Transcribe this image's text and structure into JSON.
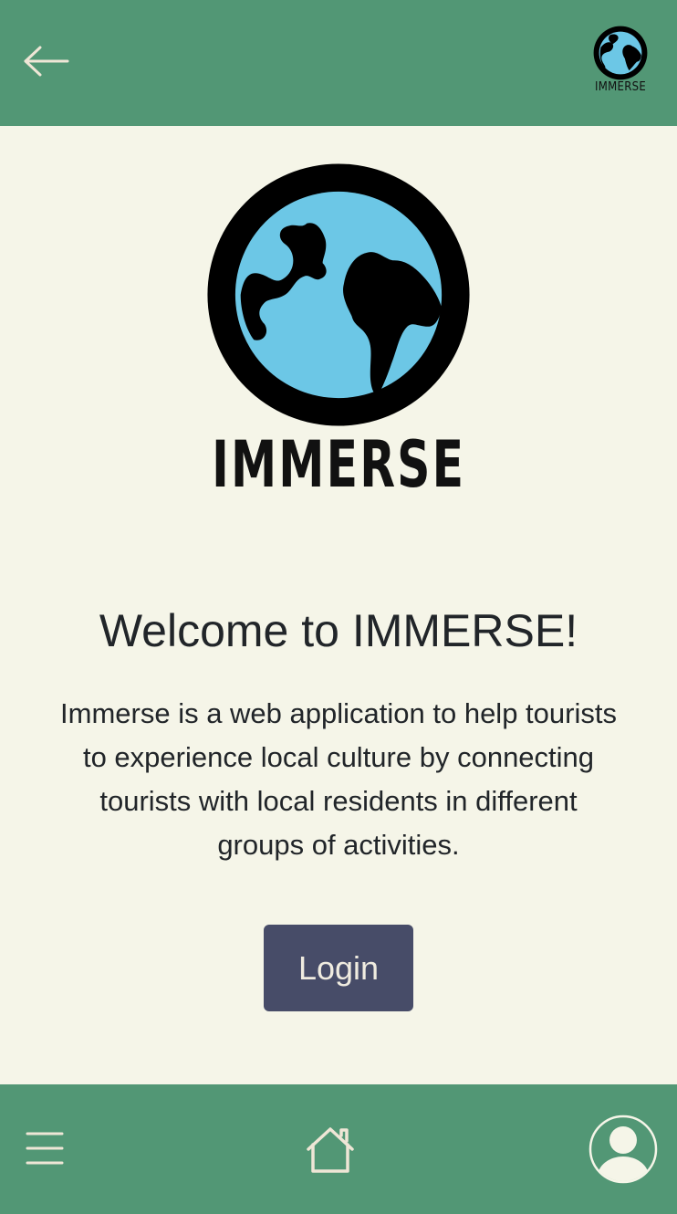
{
  "app": {
    "brand_name": "IMMERSE"
  },
  "header": {
    "back_icon": "arrow-left-icon",
    "logo_text": "IMMERSE"
  },
  "hero": {
    "logo_text": "IMMERSE",
    "title": "Welcome to IMMERSE!",
    "description": "Immerse is a web application to help tourists to experience local culture by connecting tourists with local residents in different groups of activities.",
    "login_label": "Login"
  },
  "bottom_nav": {
    "menu_icon": "hamburger-menu-icon",
    "home_icon": "home-icon",
    "profile_icon": "user-avatar-icon"
  },
  "colors": {
    "header_bg": "#529775",
    "page_bg": "#f5f5e8",
    "button_bg": "#474c68",
    "icon_stroke": "#efe6d6",
    "globe_blue": "#6cc7e6"
  }
}
